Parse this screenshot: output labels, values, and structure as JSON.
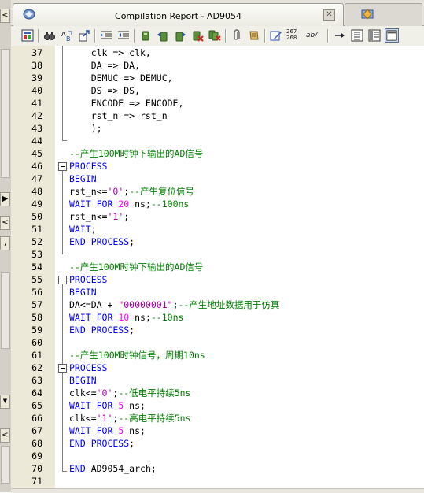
{
  "window": {
    "active_tab_title": "Compilation Report - AD9054",
    "close_glyph": "✕"
  },
  "left_panel": {
    "arrow_glyph": "<",
    "play_glyph": "▶",
    "dot_glyph": ",",
    "down_glyph": "▼"
  },
  "toolbar": {
    "line_numbers_top": "267",
    "line_numbers_bottom": "268",
    "ab_label": "ab/"
  },
  "colors": {
    "keyword": "#0000ff",
    "comment": "#008000",
    "number": "#ff00ff",
    "string": "#aa00aa",
    "gutter": "#ece9d8"
  },
  "editor": {
    "lines": [
      {
        "n": "37",
        "segs": [
          {
            "t": "    clk => clk,",
            "c": ""
          }
        ]
      },
      {
        "n": "38",
        "segs": [
          {
            "t": "    DA => DA,",
            "c": ""
          }
        ]
      },
      {
        "n": "39",
        "segs": [
          {
            "t": "    DEMUC => DEMUC,",
            "c": ""
          }
        ]
      },
      {
        "n": "40",
        "segs": [
          {
            "t": "    DS => DS,",
            "c": ""
          }
        ]
      },
      {
        "n": "41",
        "segs": [
          {
            "t": "    ENCODE => ENCODE,",
            "c": ""
          }
        ]
      },
      {
        "n": "42",
        "segs": [
          {
            "t": "    rst_n => rst_n",
            "c": ""
          }
        ]
      },
      {
        "n": "43",
        "segs": [
          {
            "t": "    );",
            "c": ""
          }
        ]
      },
      {
        "n": "44",
        "segs": []
      },
      {
        "n": "45",
        "segs": [
          {
            "t": "--产生100M时钟下输出的AD信号",
            "c": "cm"
          }
        ]
      },
      {
        "n": "46",
        "segs": [
          {
            "t": "PROCESS",
            "c": "kw"
          }
        ]
      },
      {
        "n": "47",
        "segs": [
          {
            "t": "BEGIN",
            "c": "kw"
          }
        ]
      },
      {
        "n": "48",
        "segs": [
          {
            "t": "rst_n<=",
            "c": ""
          },
          {
            "t": "'0'",
            "c": "st"
          },
          {
            "t": ";",
            "c": ""
          },
          {
            "t": "--产生复位信号",
            "c": "cm"
          }
        ]
      },
      {
        "n": "49",
        "segs": [
          {
            "t": "WAIT FOR ",
            "c": "kw"
          },
          {
            "t": "20",
            "c": "nm"
          },
          {
            "t": " ns;",
            "c": ""
          },
          {
            "t": "--100ns",
            "c": "cm"
          }
        ]
      },
      {
        "n": "50",
        "segs": [
          {
            "t": "rst_n<=",
            "c": ""
          },
          {
            "t": "'1'",
            "c": "st"
          },
          {
            "t": ";",
            "c": ""
          }
        ]
      },
      {
        "n": "51",
        "segs": [
          {
            "t": "WAIT",
            "c": "kw"
          },
          {
            "t": ";",
            "c": ""
          }
        ]
      },
      {
        "n": "52",
        "segs": [
          {
            "t": "END PROCESS",
            "c": "kw"
          },
          {
            "t": ";",
            "c": ""
          }
        ]
      },
      {
        "n": "53",
        "segs": []
      },
      {
        "n": "54",
        "segs": [
          {
            "t": "--产生100M时钟下输出的AD信号",
            "c": "cm"
          }
        ]
      },
      {
        "n": "55",
        "segs": [
          {
            "t": "PROCESS",
            "c": "kw"
          }
        ]
      },
      {
        "n": "56",
        "segs": [
          {
            "t": "BEGIN",
            "c": "kw"
          }
        ]
      },
      {
        "n": "57",
        "segs": [
          {
            "t": "DA<=DA + ",
            "c": ""
          },
          {
            "t": "\"00000001\"",
            "c": "st"
          },
          {
            "t": ";",
            "c": ""
          },
          {
            "t": "--产生地址数据用于仿真",
            "c": "cm"
          }
        ]
      },
      {
        "n": "58",
        "segs": [
          {
            "t": "WAIT FOR ",
            "c": "kw"
          },
          {
            "t": "10",
            "c": "nm"
          },
          {
            "t": " ns;",
            "c": ""
          },
          {
            "t": "--10ns",
            "c": "cm"
          }
        ]
      },
      {
        "n": "59",
        "segs": [
          {
            "t": "END PROCESS",
            "c": "kw"
          },
          {
            "t": ";",
            "c": ""
          }
        ]
      },
      {
        "n": "60",
        "segs": []
      },
      {
        "n": "61",
        "segs": [
          {
            "t": "--产生100M时钟信号，周期10ns",
            "c": "cm"
          }
        ]
      },
      {
        "n": "62",
        "segs": [
          {
            "t": "PROCESS",
            "c": "kw"
          }
        ]
      },
      {
        "n": "63",
        "segs": [
          {
            "t": "BEGIN",
            "c": "kw"
          }
        ]
      },
      {
        "n": "64",
        "segs": [
          {
            "t": "clk<=",
            "c": ""
          },
          {
            "t": "'0'",
            "c": "st"
          },
          {
            "t": ";",
            "c": ""
          },
          {
            "t": "--低电平持续5ns",
            "c": "cm"
          }
        ]
      },
      {
        "n": "65",
        "segs": [
          {
            "t": "WAIT FOR ",
            "c": "kw"
          },
          {
            "t": "5",
            "c": "nm"
          },
          {
            "t": " ns;",
            "c": ""
          }
        ]
      },
      {
        "n": "66",
        "segs": [
          {
            "t": "clk<=",
            "c": ""
          },
          {
            "t": "'1'",
            "c": "st"
          },
          {
            "t": ";",
            "c": ""
          },
          {
            "t": "--高电平持续5ns",
            "c": "cm"
          }
        ]
      },
      {
        "n": "67",
        "segs": [
          {
            "t": "WAIT FOR ",
            "c": "kw"
          },
          {
            "t": "5",
            "c": "nm"
          },
          {
            "t": " ns;",
            "c": ""
          }
        ]
      },
      {
        "n": "68",
        "segs": [
          {
            "t": "END PROCESS",
            "c": "kw"
          },
          {
            "t": ";",
            "c": ""
          }
        ]
      },
      {
        "n": "69",
        "segs": []
      },
      {
        "n": "70",
        "segs": [
          {
            "t": "END",
            "c": "kw"
          },
          {
            "t": " AD9054_arch;",
            "c": ""
          }
        ]
      },
      {
        "n": "71",
        "segs": []
      }
    ]
  }
}
